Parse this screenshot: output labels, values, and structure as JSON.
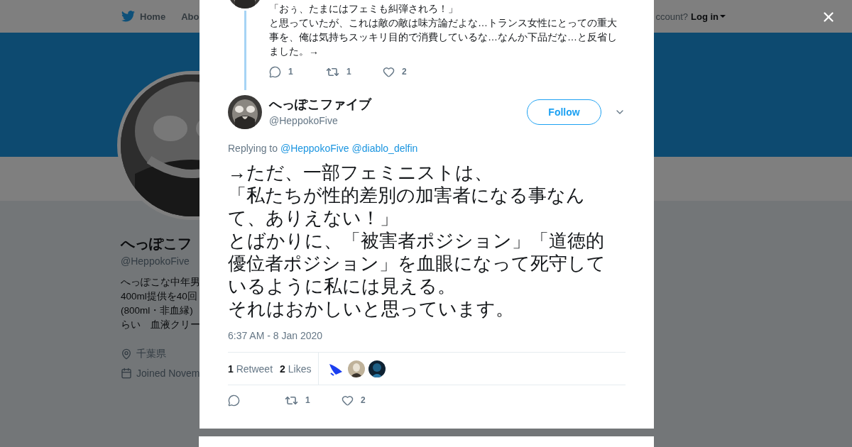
{
  "background_page": {
    "nav_items": [
      "Home",
      "Abo"
    ],
    "account_prompt": "ccount?",
    "login_link": "Log in",
    "profile": {
      "name": "へっぽこフ",
      "handle": "@HeppokoFive",
      "bio_lines": [
        "へっぽこな中年男",
        "400ml提供を40回",
        "(800ml・非血縁)",
        "らい　血液クリー"
      ],
      "location": "千葉県",
      "joined": "Joined Novem"
    }
  },
  "modal": {
    "previous_tweet": {
      "paragraphs": [
        [
          "「おぅ、たまにはフェミも糾弾されろ！」"
        ],
        [
          "と思っていたが、これは敵の敵は味方論だよな…トランス女性にとっての重大",
          "事を、俺は気持ちスッキリ目的で消費しているな…なんか下品だな…と反省し",
          "ました。→"
        ]
      ],
      "actions": [
        {
          "kind": "reply",
          "count": "1"
        },
        {
          "kind": "retweet",
          "count": "1"
        },
        {
          "kind": "like",
          "count": "2"
        }
      ]
    },
    "tweet": {
      "name": "へっぽこファイブ",
      "handle": "@HeppokoFive",
      "follow_label": "Follow",
      "replying_label": "Replying to",
      "mentions": [
        "@HeppokoFive",
        "@diablo_delfin"
      ],
      "text_lines": [
        "→ただ、一部フェミニストは、",
        "「私たちが性的差別の加害者になる事なん",
        "て、ありえない！」",
        "とばかりに、「被害者ポジション」「道徳的",
        "優位者ポジション」を血眼になって死守して",
        "いるように私には見える。",
        "それはおかしいと思っています。"
      ],
      "timestamp": "6:37 AM - 8 Jan 2020",
      "stats": [
        {
          "count": "1",
          "label": "Retweet"
        },
        {
          "count": "2",
          "label": "Likes"
        }
      ],
      "likers": [
        {
          "kind": "picture"
        },
        {
          "kind": "picture"
        },
        {
          "kind": "picture"
        }
      ],
      "actions": [
        {
          "kind": "reply"
        },
        {
          "kind": "retweet",
          "count": "1"
        },
        {
          "kind": "like",
          "count": "2"
        }
      ]
    }
  }
}
